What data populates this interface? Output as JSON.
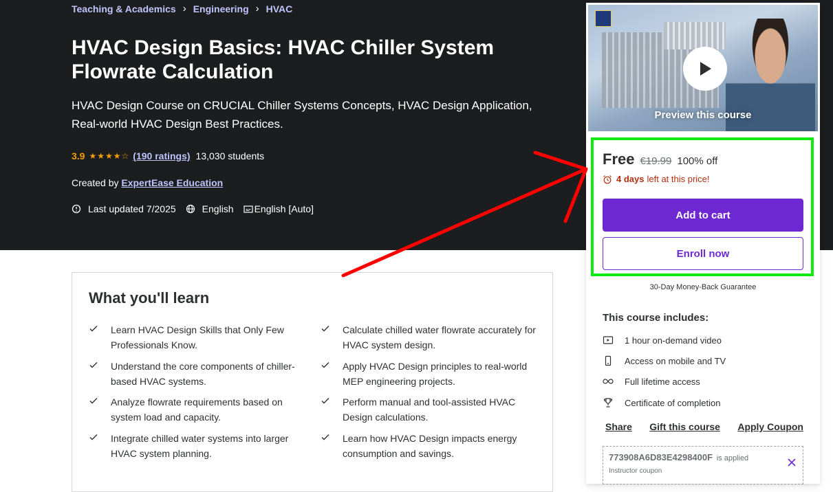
{
  "breadcrumb": [
    "Teaching & Academics",
    "Engineering",
    "HVAC"
  ],
  "course": {
    "title": "HVAC Design Basics: HVAC Chiller System Flowrate Calculation",
    "subtitle": "HVAC Design Course on CRUCIAL Chiller Systems Concepts, HVAC Design Application, Real-world HVAC Design Best Practices.",
    "rating": "3.9",
    "ratings_link": "(190 ratings)",
    "students": "13,030 students",
    "created_by_label": "Created by",
    "instructor": "ExpertEase Education",
    "last_updated": "Last updated 7/2025",
    "language": "English",
    "captions": "English [Auto]"
  },
  "learn": {
    "title": "What you'll learn",
    "items": [
      "Learn HVAC Design Skills that Only Few Professionals Know.",
      "Calculate chilled water flowrate accurately for HVAC system design.",
      "Understand the core components of chiller-based HVAC systems.",
      "Apply HVAC Design principles to real-world MEP engineering projects.",
      "Analyze flowrate requirements based on system load and capacity.",
      "Perform manual and tool-assisted HVAC Design calculations.",
      "Integrate chilled water systems into larger HVAC system planning.",
      "Learn how HVAC Design impacts energy consumption and savings."
    ]
  },
  "sidebar": {
    "preview_label": "Preview this course",
    "price": "Free",
    "old_price": "€19.99",
    "discount": "100% off",
    "timer_days": "4 days",
    "timer_text": "left at this price!",
    "add_to_cart": "Add to cart",
    "enroll_now": "Enroll now",
    "guarantee": "30-Day Money-Back Guarantee",
    "includes_title": "This course includes:",
    "includes": [
      {
        "icon": "video-icon",
        "text": "1 hour on-demand video"
      },
      {
        "icon": "mobile-icon",
        "text": "Access on mobile and TV"
      },
      {
        "icon": "infinity-icon",
        "text": "Full lifetime access"
      },
      {
        "icon": "trophy-icon",
        "text": "Certificate of completion"
      }
    ],
    "share": "Share",
    "gift": "Gift this course",
    "apply_coupon": "Apply Coupon",
    "coupon_code": "773908A6D83E4298400F",
    "coupon_applied": "is applied",
    "coupon_sub": "Instructor coupon"
  },
  "colors": {
    "hero_bg": "#1c1d1f",
    "accent_purple": "#6d28d2",
    "link_lavender": "#c0c4fc",
    "star_orange": "#f69c08",
    "timer_red": "#b32d0f",
    "annotation_green": "#12e812",
    "annotation_red": "#ff0000"
  }
}
